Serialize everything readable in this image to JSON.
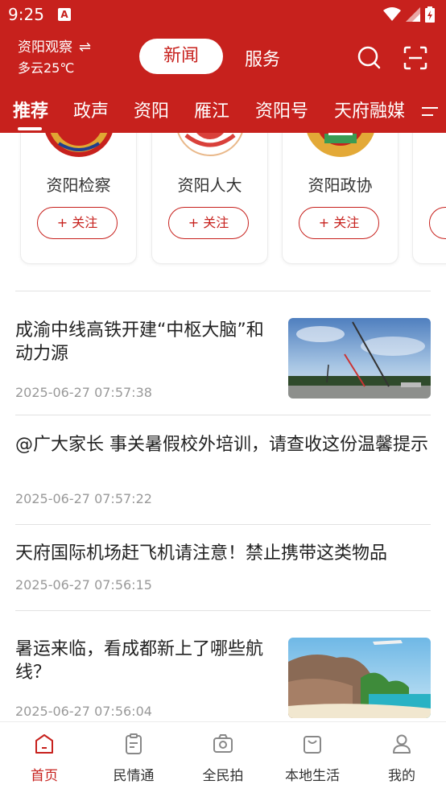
{
  "status_bar": {
    "time": "9:25",
    "notif_icon": "A"
  },
  "header": {
    "location": "资阳观察",
    "weather": "多云25℃",
    "tabs": [
      {
        "label": "新闻",
        "active": true
      },
      {
        "label": "服务",
        "active": false
      }
    ],
    "channels": [
      "推荐",
      "政声",
      "资阳",
      "雁江",
      "资阳号",
      "天府融媒"
    ],
    "accent_color": "#c7211d"
  },
  "cards": [
    {
      "name": "资阳检察",
      "follow_label": "+ 关注"
    },
    {
      "name": "资阳人大",
      "follow_label": "+ 关注"
    },
    {
      "name": "资阳政协",
      "follow_label": "+ 关注"
    }
  ],
  "news": [
    {
      "title": "成渝中线高铁开建“中枢大脑”和动力源",
      "time": "2025-06-27  07:57:38",
      "has_image": true,
      "image": "construction-cranes"
    },
    {
      "title": "@广大家长  事关暑假校外培训，请查收这份温馨提示",
      "time": "2025-06-27  07:57:22",
      "has_image": false
    },
    {
      "title": "天府国际机场赶飞机请注意！禁止携带这类物品",
      "time": "2025-06-27  07:56:15",
      "has_image": false
    },
    {
      "title": "暑运来临，看成都新上了哪些航线？",
      "time": "2025-06-27  07:56:04",
      "has_image": true,
      "image": "beach-rocks-plane"
    }
  ],
  "bottom_nav": [
    {
      "label": "首页",
      "icon": "home-icon",
      "active": true
    },
    {
      "label": "民情通",
      "icon": "clipboard-icon",
      "active": false
    },
    {
      "label": "全民拍",
      "icon": "camera-icon",
      "active": false
    },
    {
      "label": "本地生活",
      "icon": "shopping-bag-icon",
      "active": false
    },
    {
      "label": "我的",
      "icon": "user-icon",
      "active": false
    }
  ]
}
